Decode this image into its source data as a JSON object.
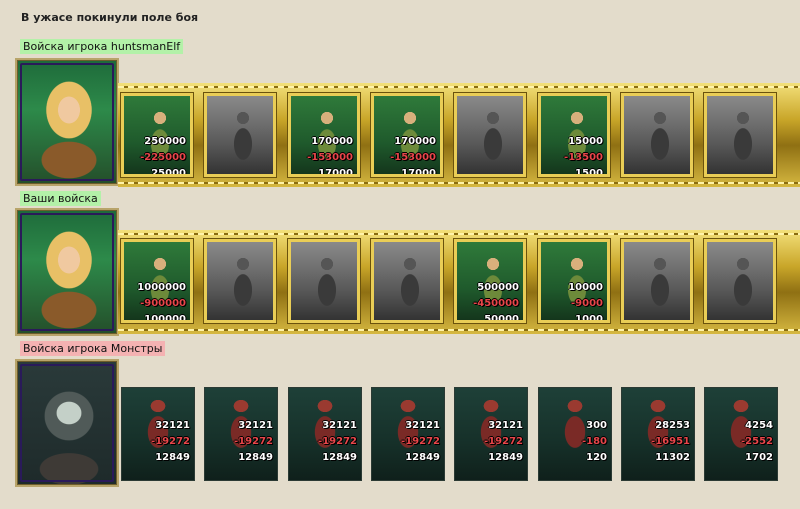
{
  "title": "В ужасе покинули поле боя",
  "groups": [
    {
      "label": "Войска игрока huntsmanElf",
      "label_color": "#b3f1a8",
      "portrait": "elf-huntress-portrait",
      "units": [
        {
          "icon": "dwarf-warrior-icon",
          "active": true,
          "total": "250000",
          "loss": "-225000",
          "remain": "25000"
        },
        {
          "icon": "dark-knight-icon",
          "active": false,
          "total": "",
          "loss": "",
          "remain": ""
        },
        {
          "icon": "elf-spearman-icon",
          "active": true,
          "total": "170000",
          "loss": "-153000",
          "remain": "17000"
        },
        {
          "icon": "green-dragon-icon",
          "active": true,
          "total": "170000",
          "loss": "-153000",
          "remain": "17000"
        },
        {
          "icon": "archer-icon",
          "active": false,
          "total": "",
          "loss": "",
          "remain": ""
        },
        {
          "icon": "druid-icon",
          "active": true,
          "total": "15000",
          "loss": "-13500",
          "remain": "1500"
        },
        {
          "icon": "hooded-figure-icon",
          "active": false,
          "total": "",
          "loss": "",
          "remain": ""
        },
        {
          "icon": "elder-druid-icon",
          "active": false,
          "total": "",
          "loss": "",
          "remain": ""
        }
      ]
    },
    {
      "label": "Ваши войска",
      "label_color": "#b3f1a8",
      "portrait": "elf-huntress-portrait",
      "units": [
        {
          "icon": "dwarf-king-icon",
          "active": true,
          "total": "1000000",
          "loss": "-900000",
          "remain": "100000"
        },
        {
          "icon": "shield-warrior-icon",
          "active": false,
          "total": "",
          "loss": "",
          "remain": ""
        },
        {
          "icon": "cavalry-icon",
          "active": false,
          "total": "",
          "loss": "",
          "remain": ""
        },
        {
          "icon": "pegasus-icon",
          "active": false,
          "total": "",
          "loss": "",
          "remain": ""
        },
        {
          "icon": "crossbowman-icon",
          "active": true,
          "total": "500000",
          "loss": "-450000",
          "remain": "50000"
        },
        {
          "icon": "green-mage-icon",
          "active": true,
          "total": "10000",
          "loss": "-9000",
          "remain": "1000"
        },
        {
          "icon": "armored-guard-icon",
          "active": false,
          "total": "",
          "loss": "",
          "remain": ""
        },
        {
          "icon": "old-sage-icon",
          "active": false,
          "total": "",
          "loss": "",
          "remain": ""
        }
      ]
    },
    {
      "label": "Войска игрока Монстры",
      "label_color": "#f4b2b2",
      "portrait": "monster-lord-portrait",
      "units": [
        {
          "icon": "spiked-beast-icon",
          "active": true,
          "total": "32121",
          "loss": "-19272",
          "remain": "12849"
        },
        {
          "icon": "stone-golem-icon",
          "active": true,
          "total": "32121",
          "loss": "-19272",
          "remain": "12849"
        },
        {
          "icon": "orc-shaman-icon",
          "active": true,
          "total": "32121",
          "loss": "-19272",
          "remain": "12849"
        },
        {
          "icon": "red-demon-icon",
          "active": true,
          "total": "32121",
          "loss": "-19272",
          "remain": "12849"
        },
        {
          "icon": "spiked-crawler-icon",
          "active": true,
          "total": "32121",
          "loss": "-19272",
          "remain": "12849"
        },
        {
          "icon": "fire-imp-icon",
          "active": true,
          "total": "300",
          "loss": "-180",
          "remain": "120"
        },
        {
          "icon": "bone-horror-icon",
          "active": true,
          "total": "28253",
          "loss": "-16951",
          "remain": "11302"
        },
        {
          "icon": "serpent-demon-icon",
          "active": true,
          "total": "4254",
          "loss": "-2552",
          "remain": "1702"
        }
      ]
    }
  ]
}
